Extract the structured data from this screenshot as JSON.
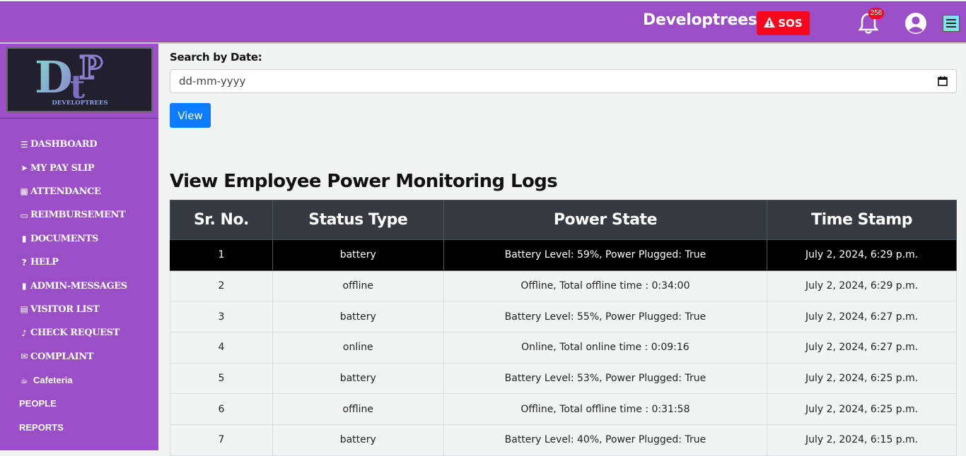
{
  "header": {
    "brand": "Developtrees",
    "sos_label": "SOS",
    "notification_count": "256",
    "colors": {
      "bar": "#9a4fc7",
      "sos": "#f5071c"
    }
  },
  "sidebar": {
    "logo_text": "DEVELOPTREES",
    "items": [
      {
        "label": "DASHBOARD",
        "icon": "list-icon"
      },
      {
        "label": "MY PAY SLIP",
        "icon": "paper-plane-icon"
      },
      {
        "label": "ATTENDANCE",
        "icon": "calendar-icon"
      },
      {
        "label": "REIMBURSEMENT",
        "icon": "credit-card-icon"
      },
      {
        "label": "DOCUMENTS",
        "icon": "file-icon"
      },
      {
        "label": "HELP",
        "icon": "question-circle-icon"
      },
      {
        "label": "ADMIN-MESSAGES",
        "icon": "file-icon"
      },
      {
        "label": "VISITOR LIST",
        "icon": "list-alt-icon"
      },
      {
        "label": "CHECK REQUEST",
        "icon": "bell-icon"
      },
      {
        "label": "COMPLAINT",
        "icon": "envelope-icon"
      },
      {
        "label": "Cafeteria",
        "icon": "coffee-icon"
      },
      {
        "label": "PEOPLE",
        "icon": ""
      },
      {
        "label": "REPORTS",
        "icon": ""
      }
    ]
  },
  "search": {
    "label": "Search by Date:",
    "placeholder": "dd-mm-yyyy",
    "button_label": "View"
  },
  "logs": {
    "title": "View Employee Power Monitoring Logs",
    "columns": [
      "Sr. No.",
      "Status Type",
      "Power State",
      "Time Stamp"
    ],
    "rows": [
      [
        "1",
        "battery",
        "Battery Level: 59%, Power Plugged: True",
        "July 2, 2024, 6:29 p.m."
      ],
      [
        "2",
        "offline",
        "Offline, Total offline time : 0:34:00",
        "July 2, 2024, 6:29 p.m."
      ],
      [
        "3",
        "battery",
        "Battery Level: 55%, Power Plugged: True",
        "July 2, 2024, 6:27 p.m."
      ],
      [
        "4",
        "online",
        "Online, Total online time : 0:09:16",
        "July 2, 2024, 6:27 p.m."
      ],
      [
        "5",
        "battery",
        "Battery Level: 53%, Power Plugged: True",
        "July 2, 2024, 6:25 p.m."
      ],
      [
        "6",
        "offline",
        "Offline, Total offline time : 0:31:58",
        "July 2, 2024, 6:25 p.m."
      ],
      [
        "7",
        "battery",
        "Battery Level: 40%, Power Plugged: True",
        "July 2, 2024, 6:15 p.m."
      ]
    ]
  }
}
